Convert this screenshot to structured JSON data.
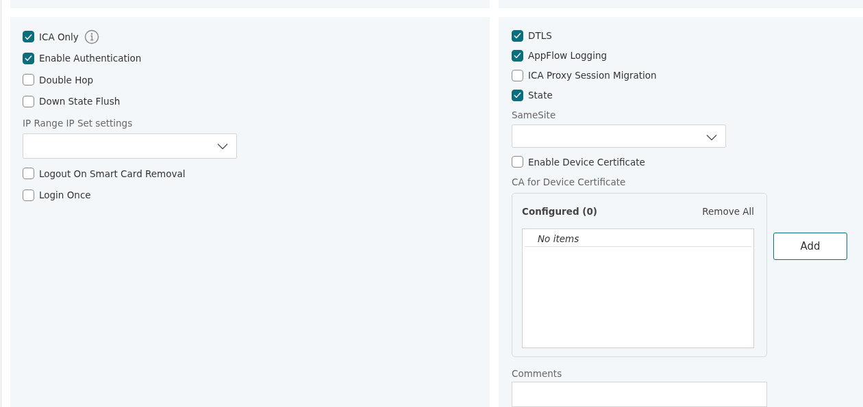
{
  "columns": [
    {
      "items": [
        {
          "kind": "checkbox",
          "label": "ICA Only",
          "checked": true,
          "info": true
        },
        {
          "kind": "checkbox",
          "label": "Enable Authentication",
          "checked": true
        },
        {
          "kind": "checkbox",
          "label": "Double Hop",
          "checked": false
        },
        {
          "kind": "checkbox",
          "label": "Down State Flush",
          "checked": false
        },
        {
          "kind": "label",
          "text": "IP Range IP Set settings"
        },
        {
          "kind": "select"
        },
        {
          "kind": "checkbox",
          "label": "Logout On Smart Card Removal",
          "checked": false
        },
        {
          "kind": "checkbox",
          "label": "Login Once",
          "checked": false
        }
      ]
    },
    {
      "items": [
        {
          "kind": "checkbox",
          "label": "DTLS",
          "checked": true
        },
        {
          "kind": "checkbox",
          "label": "AppFlow Logging",
          "checked": true
        },
        {
          "kind": "checkbox",
          "label": "ICA Proxy Session Migration",
          "checked": false
        },
        {
          "kind": "checkbox",
          "label": "State",
          "checked": true
        },
        {
          "kind": "label",
          "text": "SameSite"
        },
        {
          "kind": "select"
        },
        {
          "kind": "checkbox",
          "label": "Enable Device Certificate",
          "checked": false
        },
        {
          "kind": "label",
          "text": "CA for Device Certificate"
        },
        {
          "kind": "listbox",
          "title": "Configured (0)",
          "action": "Remove All",
          "empty": "No items",
          "button": "Add"
        },
        {
          "kind": "label",
          "text": "Comments"
        },
        {
          "kind": "textarea"
        }
      ]
    }
  ]
}
